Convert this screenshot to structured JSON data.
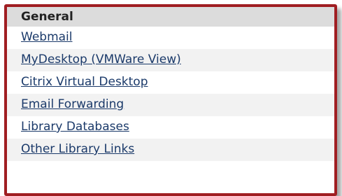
{
  "panel": {
    "title": "General",
    "links": [
      "Webmail",
      "MyDesktop (VMWare View)",
      "Citrix Virtual Desktop",
      "Email Forwarding",
      "Library Databases",
      "Other Library Links"
    ]
  },
  "colors": {
    "frame": "#a01e22",
    "header_bg": "#dcdcdc",
    "link": "#1b3a6a"
  }
}
